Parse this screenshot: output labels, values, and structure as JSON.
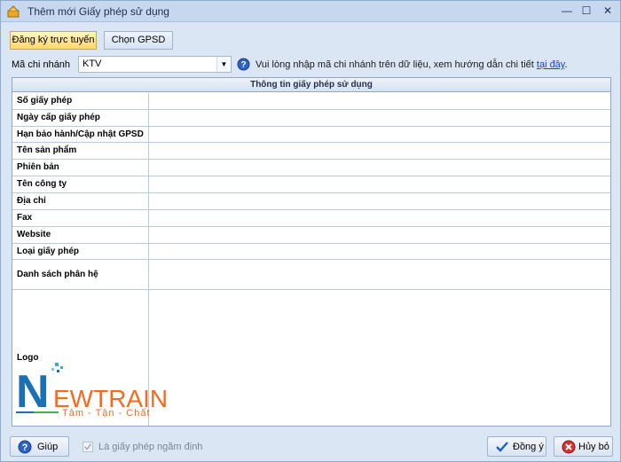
{
  "window": {
    "title": "Thêm mới Giấy phép sử dụng",
    "minimize": "—",
    "maximize": "☐",
    "close": "✕"
  },
  "tabs": [
    {
      "label": "Đăng ký trực tuyến",
      "active": true
    },
    {
      "label": "Chọn GPSD",
      "active": false
    }
  ],
  "branch": {
    "label": "Mã chi nhánh",
    "value": "KTV"
  },
  "help": {
    "text": "Vui lòng nhập mã chi nhánh trên dữ liệu, xem hướng dẫn chi tiết ",
    "link": "tại đây",
    "suffix": "."
  },
  "grid": {
    "header": "Thông tin giấy phép sử dụng",
    "rows": [
      {
        "label": "Số giấy phép",
        "value": ""
      },
      {
        "label": "Ngày cấp giấy phép",
        "value": ""
      },
      {
        "label": "Hạn bảo hành/Cập nhật GPSD",
        "value": ""
      },
      {
        "label": "Tên sản phẩm",
        "value": ""
      },
      {
        "label": "Phiên bản",
        "value": ""
      },
      {
        "label": "Tên công ty",
        "value": ""
      },
      {
        "label": "Địa chỉ",
        "value": ""
      },
      {
        "label": "Fax",
        "value": ""
      },
      {
        "label": "Website",
        "value": ""
      },
      {
        "label": "Loại giấy phép",
        "value": ""
      },
      {
        "label": "Danh sách phân hệ",
        "value": ""
      }
    ],
    "logo_label": "Logo",
    "logo": {
      "brand_n": "N",
      "brand_rest": "EWTRAIN",
      "tagline": "Tâm - Tận - Chất"
    }
  },
  "footer": {
    "help_button": "Giúp",
    "default_license_checkbox": "Là giấy phép ngầm định",
    "default_license_checked": true,
    "ok_button": "Đồng ý",
    "cancel_button": "Hủy bỏ"
  },
  "colors": {
    "accent": "#ffd76e",
    "grid_border": "#8ea7cc",
    "link": "#1a3fd6",
    "logo_blue": "#1a6fb5",
    "logo_orange": "#f26b21"
  }
}
